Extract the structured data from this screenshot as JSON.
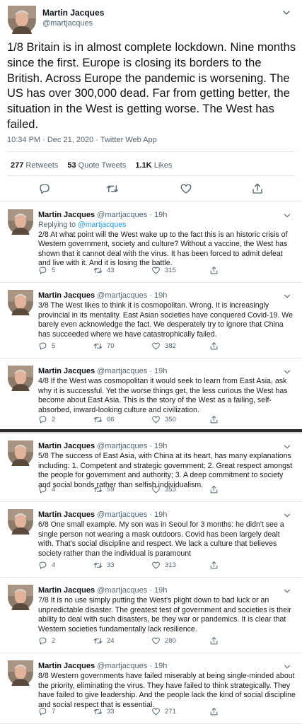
{
  "main_tweet": {
    "name": "Martin Jacques",
    "handle": "@martjacques",
    "text": "1/8 Britain is in almost complete lockdown. Nine months since the first. Europe is closing its borders to the British. Across Europe the pandemic is worsening. The US has over 300,000 dead. Far from getting better, the situation in the West is getting worse. The West has failed.",
    "meta": "10:34 PM · Dec 21, 2020 · Twitter Web App",
    "retweets_count": "277",
    "retweets_label": "Retweets",
    "quotes_count": "53",
    "quotes_label": "Quote Tweets",
    "likes_count": "1.1K",
    "likes_label": "Likes",
    "icons": [
      "reply-icon",
      "retweet-icon",
      "like-icon",
      "share-icon"
    ]
  },
  "replies": [
    {
      "name": "Martin Jacques",
      "handle": "@martjacques · 19h",
      "replying_prefix": "Replying to",
      "replying_to": "@martjacques",
      "text": "2/8 At what point will the West wake up to the fact this is an historic crisis of Western government, society and culture? Without a vaccine, the West has shown that it cannot deal with the virus. It has been forced to admit defeat and live with it. And it is losing the battle.",
      "replies": "5",
      "retweets": "43",
      "likes": "315"
    },
    {
      "name": "Martin Jacques",
      "handle": "@martjacques · 19h",
      "text": "3/8 The West likes to think it is cosmopolitan. Wrong. It is increasingly provincial in its mentality. East Asian societies have conquered Covid-19. We barely even acknowledge the fact. We desperately try to ignore that China has succeeded where we have catastrophically failed.",
      "replies": "5",
      "retweets": "70",
      "likes": "382"
    },
    {
      "name": "Martin Jacques",
      "handle": "@martjacques · 19h",
      "text": "4/8 If the West was cosmopolitan it would seek to learn from East Asia, ask why it is successful. Yet the worse things get, the less curious the West has become about East Asia. This is the story of the West as a failing, self-absorbed, inward-looking culture and civilization.",
      "replies": "2",
      "retweets": "66",
      "likes": "350"
    },
    {
      "name": "Martin Jacques",
      "handle": "@martjacques · 19h",
      "text": "5/8 The success of East Asia, with China at its heart, has many explanations including: 1. Competent and strategic government;  2. Great respect amongst the people for government and authority; 3. A deep commitment to society and social bonds rather than selfish individualism.",
      "replies": "4",
      "retweets": "59",
      "likes": "353"
    },
    {
      "name": "Martin Jacques",
      "handle": "@martjacques · 19h",
      "text": "6/8 One small example. My son was in Seoul for 3 months: he didn't see a single person not wearing a mask outdoors. Covid has been largely dealt with. That's social discipline and respect. We lack a culture that believes society rather than the individual is paramount",
      "replies": "4",
      "retweets": "33",
      "likes": "313"
    },
    {
      "name": "Martin Jacques",
      "handle": "@martjacques · 19h",
      "text": "7/8 It is no use simply putting the West's plight down to bad luck or an unpredictable disaster. The greatest test of government and societies is their ability to deal with such disasters, be they war or pandemics. It is clear that Western societies fundamentally lack resilience.",
      "replies": "2",
      "retweets": "24",
      "likes": "280"
    },
    {
      "name": "Martin Jacques",
      "handle": "@martjacques · 19h",
      "text": "8/8 Western governments have failed miserably at being single-minded about the priority, eliminating the virus. They have failed to think strategically. They have failed to give leadership. And the people lack the kind of social discipline and social respect that is essential.",
      "replies": "7",
      "retweets": "33",
      "likes": "271"
    }
  ]
}
